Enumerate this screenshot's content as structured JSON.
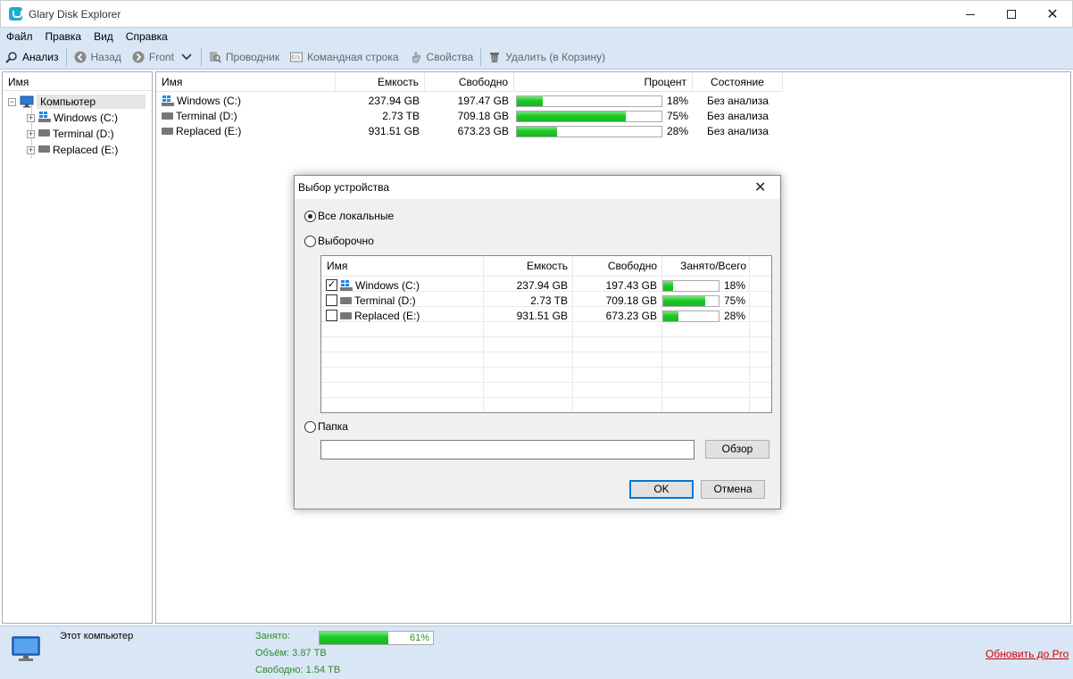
{
  "window": {
    "title": "Glary Disk Explorer"
  },
  "menu": [
    "Файл",
    "Правка",
    "Вид",
    "Справка"
  ],
  "toolbar": {
    "analyze": "Анализ",
    "back": "Назад",
    "front": "Front",
    "explorer": "Проводник",
    "cmd": "Командная строка",
    "properties": "Свойства",
    "delete": "Удалить (в Корзину)"
  },
  "tree": {
    "header": "Имя",
    "root": "Компьютер",
    "items": [
      "Windows (C:)",
      "Terminal (D:)",
      "Replaced (E:)"
    ]
  },
  "drive_list": {
    "columns": [
      "Имя",
      "Емкость",
      "Свободно",
      "Процент",
      "Состояние"
    ],
    "rows": [
      {
        "name": "Windows (C:)",
        "capacity": "237.94 GB",
        "free": "197.47 GB",
        "percent": "18%",
        "fill": 18,
        "state": "Без анализа"
      },
      {
        "name": "Terminal (D:)",
        "capacity": "2.73 TB",
        "free": "709.18 GB",
        "percent": "75%",
        "fill": 75,
        "state": "Без анализа"
      },
      {
        "name": "Replaced (E:)",
        "capacity": "931.51 GB",
        "free": "673.23 GB",
        "percent": "28%",
        "fill": 28,
        "state": "Без анализа"
      }
    ]
  },
  "dialog": {
    "title": "Выбор устройства",
    "radio_all": "Все локальные",
    "radio_select": "Выборочно",
    "radio_folder": "Папка",
    "columns": [
      "Имя",
      "Емкость",
      "Свободно",
      "Занято/Всего"
    ],
    "rows": [
      {
        "name": "Windows (C:)",
        "checked": true,
        "capacity": "237.94 GB",
        "free": "197.43 GB",
        "percent": "18%",
        "fill": 18
      },
      {
        "name": "Terminal (D:)",
        "checked": false,
        "capacity": "2.73 TB",
        "free": "709.18 GB",
        "percent": "75%",
        "fill": 75
      },
      {
        "name": "Replaced (E:)",
        "checked": false,
        "capacity": "931.51 GB",
        "free": "673.23 GB",
        "percent": "28%",
        "fill": 28
      }
    ],
    "folder_value": "",
    "browse": "Обзор",
    "ok": "OK",
    "cancel": "Отмена"
  },
  "status": {
    "computer": "Этот компьютер",
    "used_label": "Занято:",
    "used_percent": "61%",
    "used_fill": 61,
    "volume": "Объём: 3.87 TB",
    "free": "Свободно: 1.54 TB",
    "upgrade": "Обновить до Pro"
  }
}
